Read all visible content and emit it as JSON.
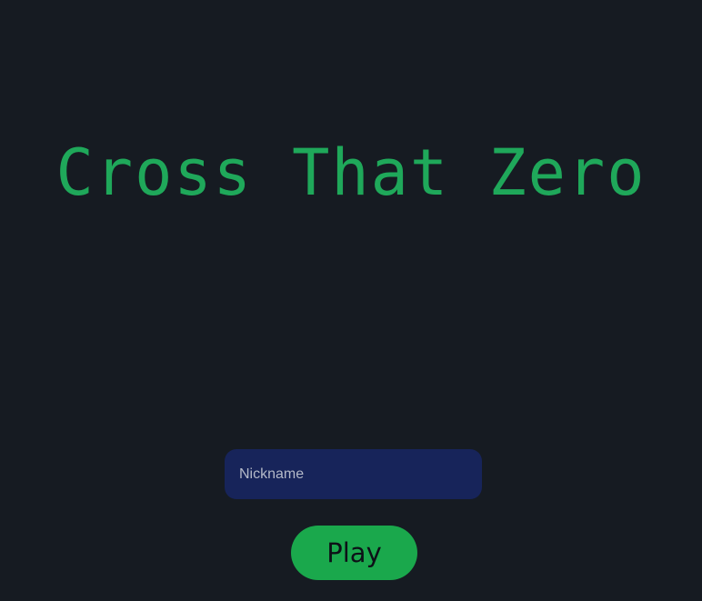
{
  "app": {
    "title": "Cross That Zero"
  },
  "form": {
    "nickname_placeholder": "Nickname",
    "nickname_value": "",
    "play_label": "Play"
  },
  "colors": {
    "background": "#161b22",
    "title": "#1fa85a",
    "input_bg": "#17245a",
    "button_bg": "#1aa84c"
  }
}
